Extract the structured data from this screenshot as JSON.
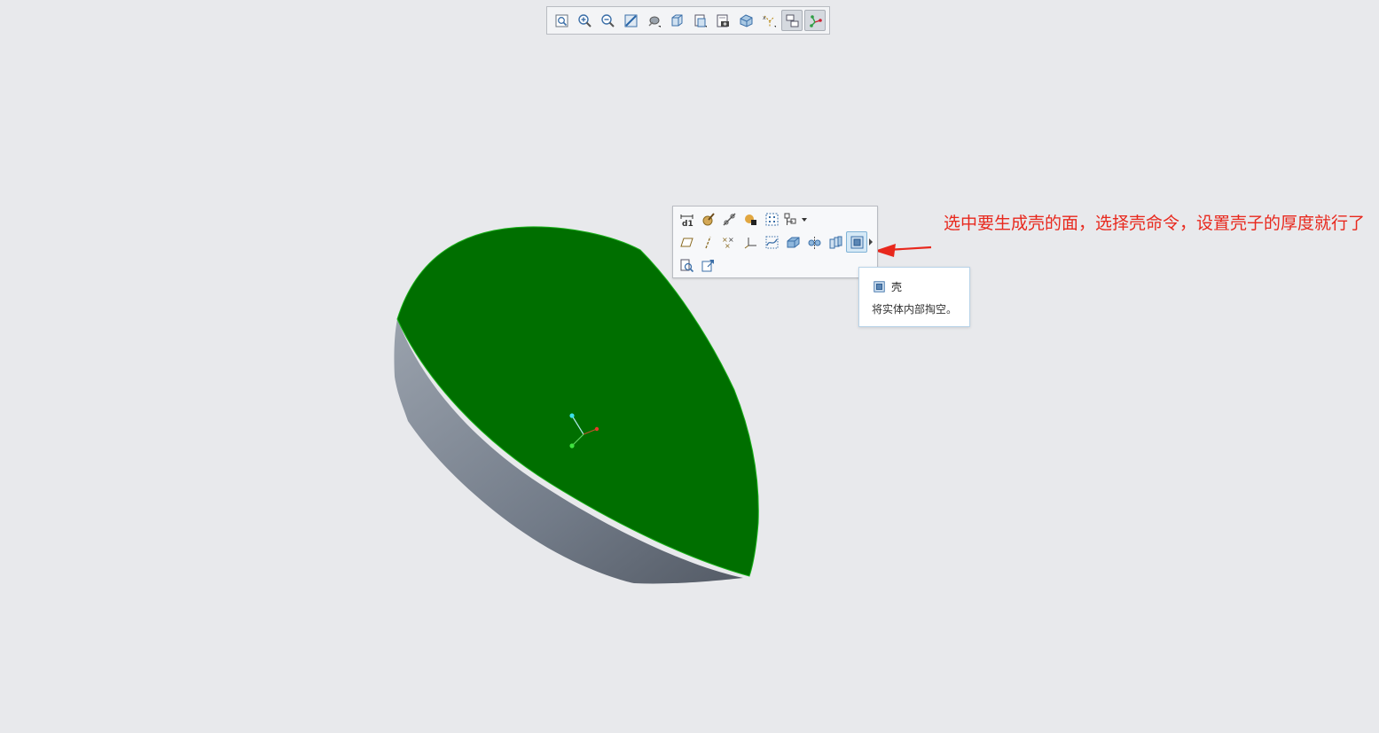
{
  "view_toolbar": {
    "buttons": [
      {
        "icon": "refit-icon"
      },
      {
        "icon": "zoom-in-icon"
      },
      {
        "icon": "zoom-out-icon"
      },
      {
        "icon": "repaint-icon"
      },
      {
        "icon": "display-style-icon"
      },
      {
        "icon": "saved-orientations-icon"
      },
      {
        "icon": "view-manager-icon"
      },
      {
        "icon": "perspective-view-icon"
      },
      {
        "icon": "section-icon"
      },
      {
        "icon": "datum-display-icon"
      },
      {
        "icon": "annotation-display-icon",
        "active": true
      },
      {
        "icon": "spin-center-icon",
        "active": true
      }
    ]
  },
  "mini_toolbar": {
    "row1": [
      "dimension-icon",
      "appearance-icon",
      "chain-icon",
      "color-icon",
      "select-box-icon",
      "dropdown-tool-icon"
    ],
    "row2": [
      "plane-icon",
      "axis-icon",
      "point-icon",
      "csys-icon",
      "sketch-icon",
      "extrude-icon",
      "mirror-icon",
      "pattern-icon",
      "shell-icon"
    ],
    "row3": [
      "inspect-icon",
      "edit-icon"
    ]
  },
  "tooltip": {
    "title": "壳",
    "description": "将实体内部掏空。"
  },
  "annotation": {
    "text": "选中要生成壳的面，选择壳命令，设置壳子的厚度就行了",
    "color": "#e8281d"
  },
  "colors": {
    "background": "#e8e9ec",
    "selected_face": "#006f00",
    "side_face": "#7c8593"
  }
}
